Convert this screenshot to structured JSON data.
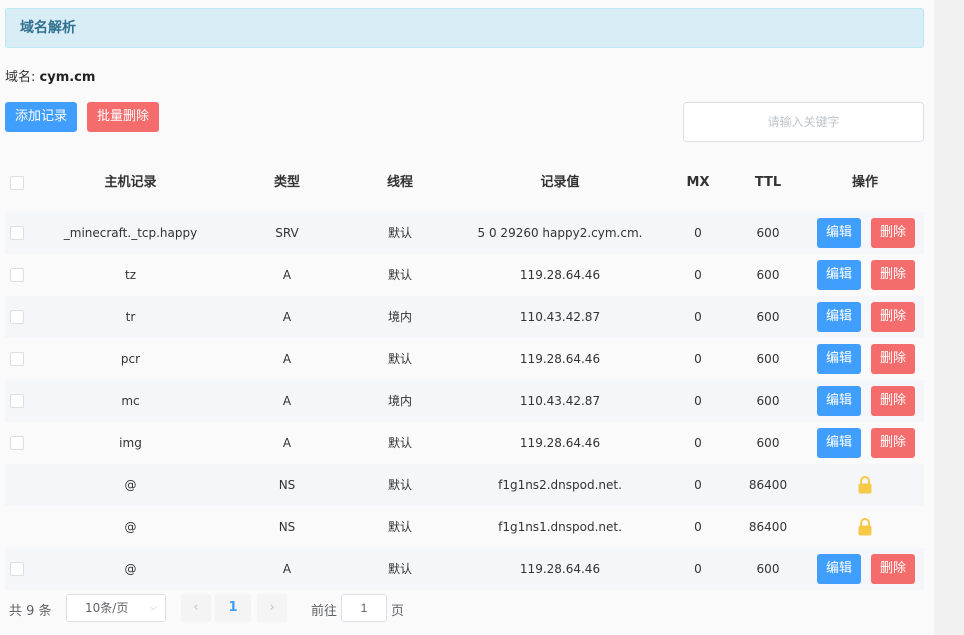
{
  "header": {
    "title": "域名解析"
  },
  "domain": {
    "label": "域名: ",
    "value": "cym.cm"
  },
  "toolbar": {
    "add_label": "添加记录",
    "bulk_delete_label": "批量删除",
    "search_placeholder": "请输入关键字"
  },
  "table": {
    "columns": [
      "主机记录",
      "类型",
      "线程",
      "记录值",
      "MX",
      "TTL",
      "操作"
    ],
    "rows": [
      {
        "host": "_minecraft._tcp.happy",
        "type": "SRV",
        "line": "默认",
        "value": "5 0 29260 happy2.cym.cm.",
        "mx": "0",
        "ttl": "600",
        "locked": false
      },
      {
        "host": "tz",
        "type": "A",
        "line": "默认",
        "value": "119.28.64.46",
        "mx": "0",
        "ttl": "600",
        "locked": false
      },
      {
        "host": "tr",
        "type": "A",
        "line": "境内",
        "value": "110.43.42.87",
        "mx": "0",
        "ttl": "600",
        "locked": false
      },
      {
        "host": "pcr",
        "type": "A",
        "line": "默认",
        "value": "119.28.64.46",
        "mx": "0",
        "ttl": "600",
        "locked": false
      },
      {
        "host": "mc",
        "type": "A",
        "line": "境内",
        "value": "110.43.42.87",
        "mx": "0",
        "ttl": "600",
        "locked": false
      },
      {
        "host": "img",
        "type": "A",
        "line": "默认",
        "value": "119.28.64.46",
        "mx": "0",
        "ttl": "600",
        "locked": false
      },
      {
        "host": "@",
        "type": "NS",
        "line": "默认",
        "value": "f1g1ns2.dnspod.net.",
        "mx": "0",
        "ttl": "86400",
        "locked": true
      },
      {
        "host": "@",
        "type": "NS",
        "line": "默认",
        "value": "f1g1ns1.dnspod.net.",
        "mx": "0",
        "ttl": "86400",
        "locked": true
      },
      {
        "host": "@",
        "type": "A",
        "line": "默认",
        "value": "119.28.64.46",
        "mx": "0",
        "ttl": "600",
        "locked": false
      }
    ],
    "edit_label": "编辑",
    "delete_label": "删除",
    "lock_icon": "lock-icon"
  },
  "pagination": {
    "total_text": "共 9 条",
    "page_size": "10条/页",
    "current_page": "1",
    "goto_label": "前往",
    "goto_value": "1",
    "page_suffix": "页",
    "prev_icon": "‹",
    "next_icon": "›"
  },
  "colors": {
    "primary": "#409eff",
    "danger": "#f56c6c",
    "lock": "#f7c948",
    "header_bg": "#d9edf7"
  }
}
